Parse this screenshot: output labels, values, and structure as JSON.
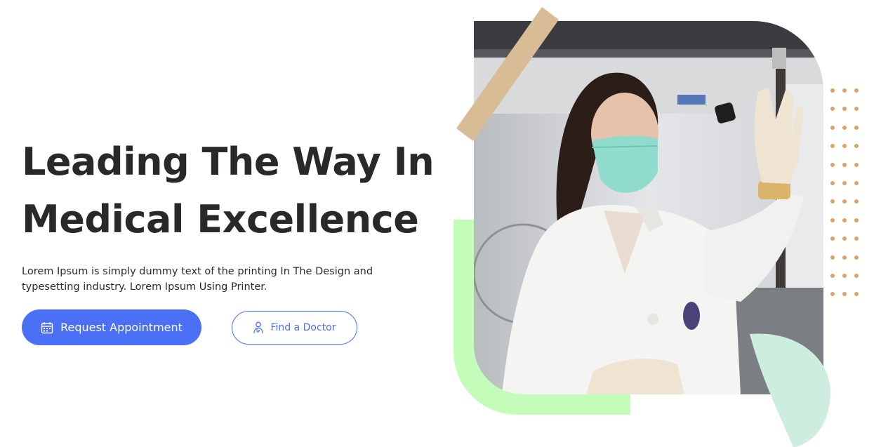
{
  "hero": {
    "headline_line1": "Leading The Way In",
    "headline_line2": "Medical Excellence",
    "description": "Lorem Ipsum is simply dummy text of the printing In The Design and typesetting industry. Lorem Ipsum Using Printer."
  },
  "buttons": {
    "primary_label": "Request Appointment",
    "primary_icon": "calendar-icon",
    "secondary_label": "Find a Doctor",
    "secondary_icon": "doctor-icon"
  },
  "image": {
    "alt": "Scientist in lab coat and face mask holding a vial"
  },
  "colors": {
    "accent_blue": "#4b70f5",
    "heading": "#2a2828",
    "green_frame": "#c4fdb9",
    "mint_shape": "#cdeede",
    "tape": "#d8bc95",
    "dots": "#d9a369"
  }
}
